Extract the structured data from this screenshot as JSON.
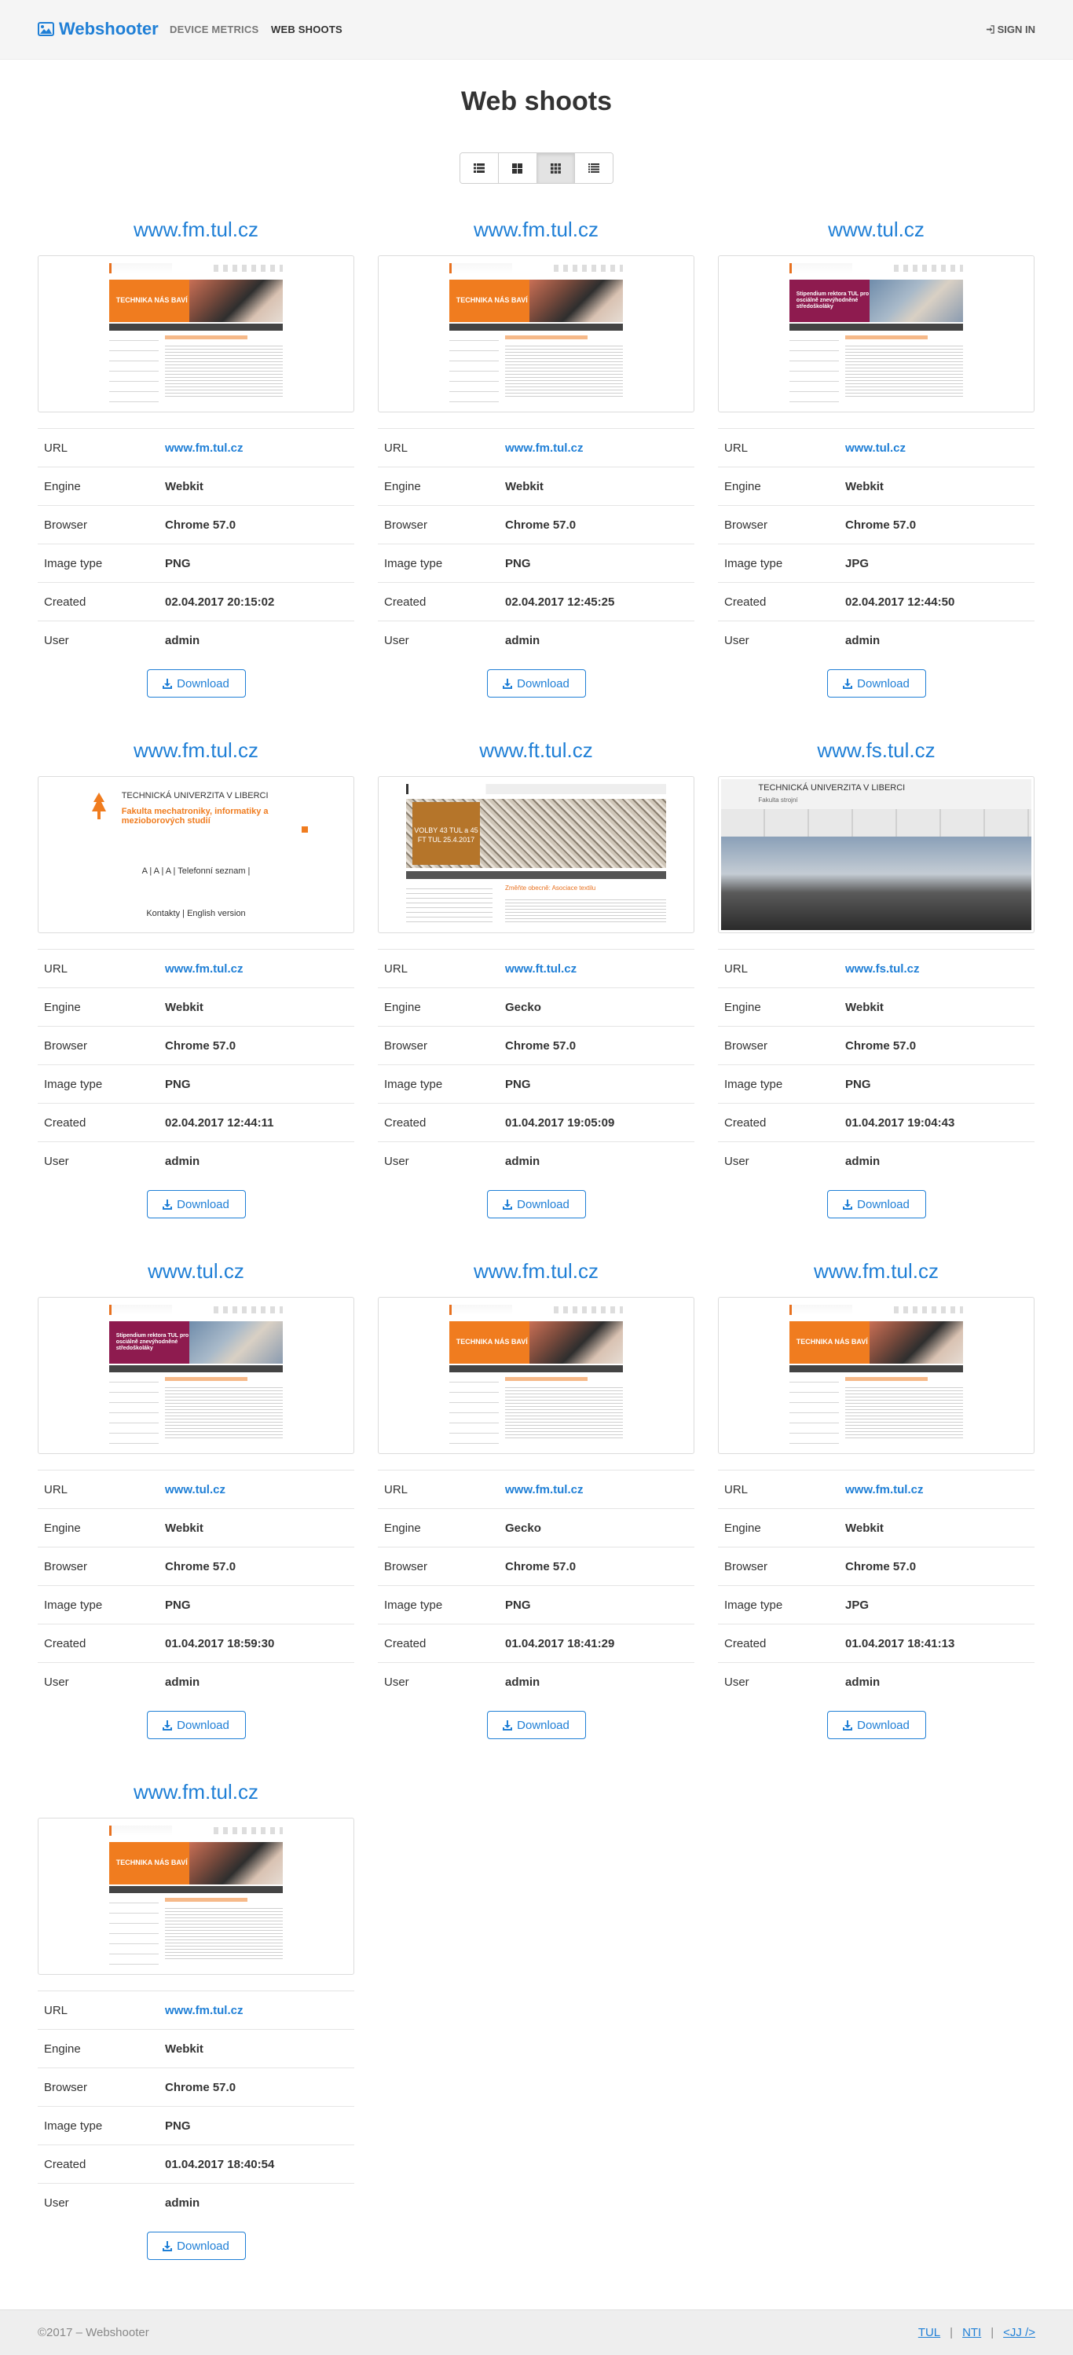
{
  "navbar": {
    "brand": "Webshooter",
    "links": [
      "DEVICE METRICS",
      "WEB SHOOTS"
    ],
    "signin": "SIGN IN"
  },
  "page": {
    "title": "Web shoots"
  },
  "labels": {
    "url": "URL",
    "engine": "Engine",
    "browser": "Browser",
    "image_type": "Image type",
    "created": "Created",
    "user": "User",
    "download": "Download"
  },
  "shoots": [
    {
      "title": "www.fm.tul.cz",
      "url": "www.fm.tul.cz",
      "engine": "Webkit",
      "browser": "Chrome 57.0",
      "image_type": "PNG",
      "created": "02.04.2017 20:15:02",
      "user": "admin",
      "thumb": "fm"
    },
    {
      "title": "www.fm.tul.cz",
      "url": "www.fm.tul.cz",
      "engine": "Webkit",
      "browser": "Chrome 57.0",
      "image_type": "PNG",
      "created": "02.04.2017 12:45:25",
      "user": "admin",
      "thumb": "fm"
    },
    {
      "title": "www.tul.cz",
      "url": "www.tul.cz",
      "engine": "Webkit",
      "browser": "Chrome 57.0",
      "image_type": "JPG",
      "created": "02.04.2017 12:44:50",
      "user": "admin",
      "thumb": "tul"
    },
    {
      "title": "www.fm.tul.cz",
      "url": "www.fm.tul.cz",
      "engine": "Webkit",
      "browser": "Chrome 57.0",
      "image_type": "PNG",
      "created": "02.04.2017 12:44:11",
      "user": "admin",
      "thumb": "lecture"
    },
    {
      "title": "www.ft.tul.cz",
      "url": "www.ft.tul.cz",
      "engine": "Gecko",
      "browser": "Chrome 57.0",
      "image_type": "PNG",
      "created": "01.04.2017 19:05:09",
      "user": "admin",
      "thumb": "volby"
    },
    {
      "title": "www.fs.tul.cz",
      "url": "www.fs.tul.cz",
      "engine": "Webkit",
      "browser": "Chrome 57.0",
      "image_type": "PNG",
      "created": "01.04.2017 19:04:43",
      "user": "admin",
      "thumb": "graduation"
    },
    {
      "title": "www.tul.cz",
      "url": "www.tul.cz",
      "engine": "Webkit",
      "browser": "Chrome 57.0",
      "image_type": "PNG",
      "created": "01.04.2017 18:59:30",
      "user": "admin",
      "thumb": "tul"
    },
    {
      "title": "www.fm.tul.cz",
      "url": "www.fm.tul.cz",
      "engine": "Gecko",
      "browser": "Chrome 57.0",
      "image_type": "PNG",
      "created": "01.04.2017 18:41:29",
      "user": "admin",
      "thumb": "fm"
    },
    {
      "title": "www.fm.tul.cz",
      "url": "www.fm.tul.cz",
      "engine": "Webkit",
      "browser": "Chrome 57.0",
      "image_type": "JPG",
      "created": "01.04.2017 18:41:13",
      "user": "admin",
      "thumb": "fm"
    },
    {
      "title": "www.fm.tul.cz",
      "url": "www.fm.tul.cz",
      "engine": "Webkit",
      "browser": "Chrome 57.0",
      "image_type": "PNG",
      "created": "01.04.2017 18:40:54",
      "user": "admin",
      "thumb": "fm"
    }
  ],
  "thumb_text": {
    "fm_banner": "TECHNIKA NÁS BAVÍ",
    "tul_banner": "Stipendium rektora TUL pro osciálně znevýhodněné středoškoláky",
    "lecture_line1": "TECHNICKÁ UNIVERZITA V LIBERCI",
    "lecture_line2": "Fakulta mechatroniky, informatiky a mezioborových studií",
    "lecture_tools": "A  |  A  |  A  |  Telefonní seznam  |",
    "lecture_footer": "Kontakty  |  English version",
    "volby_text": "VOLBY 43 TUL a 45 FT TUL 25.4.2017",
    "volby_link": "Změňte obecně: Asociace textilu",
    "graduation_line1": "TECHNICKÁ UNIVERZITA V LIBERCI",
    "graduation_line2": "Fakulta strojní"
  },
  "footer": {
    "copyright": "©2017 – Webshooter",
    "links": [
      "TUL",
      "NTI",
      "<JJ />"
    ]
  },
  "colors": {
    "brand": "#1f7fd6",
    "navbar_bg": "#f5f5f5",
    "footer_bg": "#eeeeee",
    "fm_orange": "#f07c1f",
    "tul_purple": "#8e1b4f"
  },
  "icons": {
    "brand": "image-icon",
    "signin": "sign-in-icon",
    "download": "download-icon",
    "view_modes": [
      "list-icon",
      "grid-icon",
      "grid-small-icon",
      "list-detail-icon"
    ]
  }
}
